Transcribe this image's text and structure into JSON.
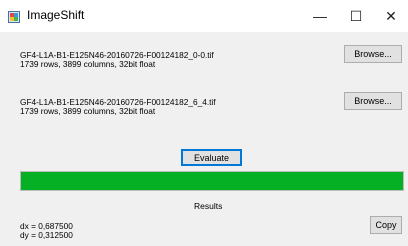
{
  "window": {
    "title": "ImageShift",
    "minimize_glyph": "—",
    "maximize_glyph": "☐",
    "close_glyph": "✕",
    "titlebar_bg": "#ffffff",
    "body_bg": "#f0f0f0"
  },
  "files": [
    {
      "name": "GF4-L1A-B1-E125N46-20160726-F00124182_0-0.tif",
      "info": "1739 rows, 3899 columns, 32bit float",
      "browse_label": "Browse..."
    },
    {
      "name": "GF4-L1A-B1-E125N46-20160726-F00124182_6_4.tif",
      "info": "1739 rows, 3899 columns, 32bit float",
      "browse_label": "Browse..."
    }
  ],
  "evaluate_label": "Evaluate",
  "progress": {
    "value_percent": 100,
    "fill_color": "#06b025"
  },
  "results": {
    "label": "Results",
    "dx": "dx = 0,687500",
    "dy": "dy = 0,312500",
    "copy_label": "Copy"
  }
}
